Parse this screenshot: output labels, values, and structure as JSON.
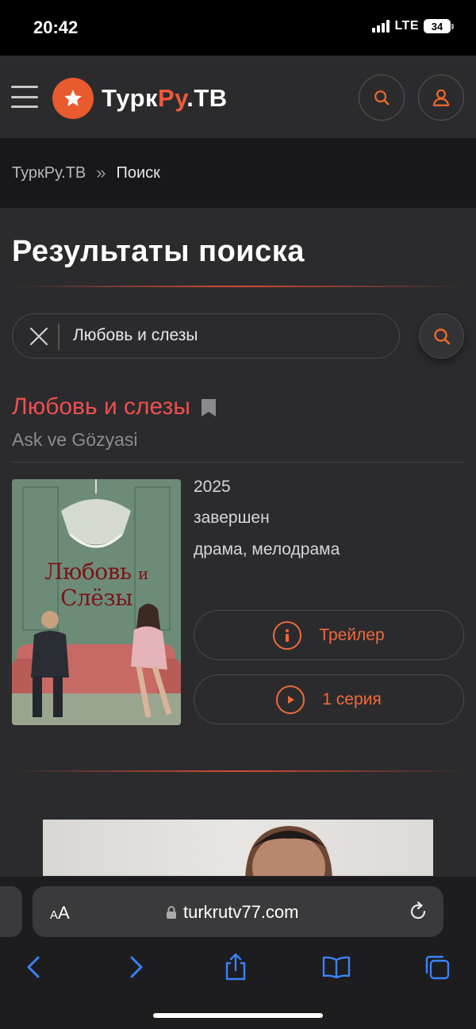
{
  "status_bar": {
    "time": "20:42",
    "network": "LTE",
    "battery": "34"
  },
  "header": {
    "logo_part1": "Турк",
    "logo_part2": "Ру",
    "logo_part3": ".ТВ",
    "icons": {
      "menu": "menu-icon",
      "logo": "star-logo-icon",
      "search": "search-icon",
      "user": "user-icon"
    },
    "accent_color": "#ef5a3a"
  },
  "breadcrumb": {
    "home": "ТуркРу.ТВ",
    "separator": "»",
    "current": "Поиск"
  },
  "main": {
    "page_title": "Результаты поиска",
    "search": {
      "value": "Любовь и слезы"
    },
    "result": {
      "title": "Любовь и слезы",
      "original_title": "Ask ve Gözyasi",
      "poster_text_1": "Любовь",
      "poster_text_2": "и",
      "poster_text_3": "Слёзы",
      "year": "2025",
      "status": "завершен",
      "genres": "драма, мелодрама",
      "trailer_label": "Трейлер",
      "episode_label": "1 серия"
    }
  },
  "browser": {
    "aa_small": "A",
    "aa_large": "A",
    "url": "turkrutv77.com",
    "icons": {
      "lock": "lock-icon",
      "reload": "reload-icon",
      "back": "back-icon",
      "forward": "forward-icon",
      "share": "share-icon",
      "bookmarks": "bookmarks-icon",
      "tabs": "tabs-icon"
    },
    "accent_color": "#3b82f6"
  }
}
